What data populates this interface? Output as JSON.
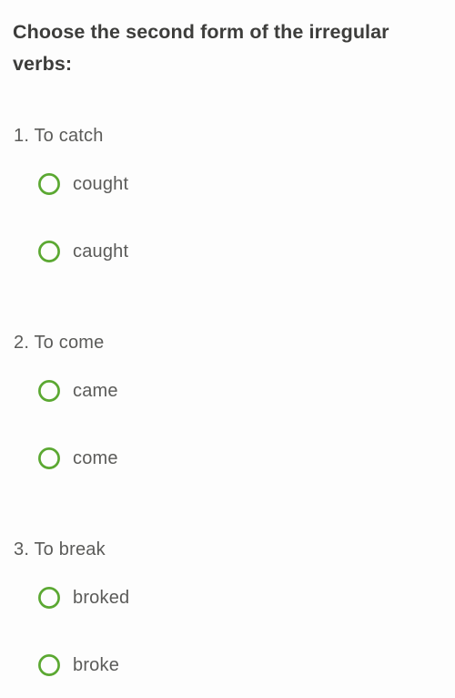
{
  "colors": {
    "background": "#fdfdfd",
    "prompt_text": "#3d3d3b",
    "body_text": "#5b5b59",
    "radio_green": "#5ba832"
  },
  "prompt": {
    "text": "Choose the second form of the irregular verbs:"
  },
  "icons": {
    "radio_unselected": "radio-unchecked-icon"
  },
  "questions": [
    {
      "number": "1.",
      "title": "1. To catch",
      "verb": "To catch",
      "options": [
        {
          "label": "cought",
          "selected": false
        },
        {
          "label": "caught",
          "selected": false
        }
      ]
    },
    {
      "number": "2.",
      "title": "2. To come",
      "verb": "To come",
      "options": [
        {
          "label": "came",
          "selected": false
        },
        {
          "label": "come",
          "selected": false
        }
      ]
    },
    {
      "number": "3.",
      "title": "3. To break",
      "verb": "To break",
      "options": [
        {
          "label": "broked",
          "selected": false
        },
        {
          "label": "broke",
          "selected": false
        }
      ]
    }
  ]
}
